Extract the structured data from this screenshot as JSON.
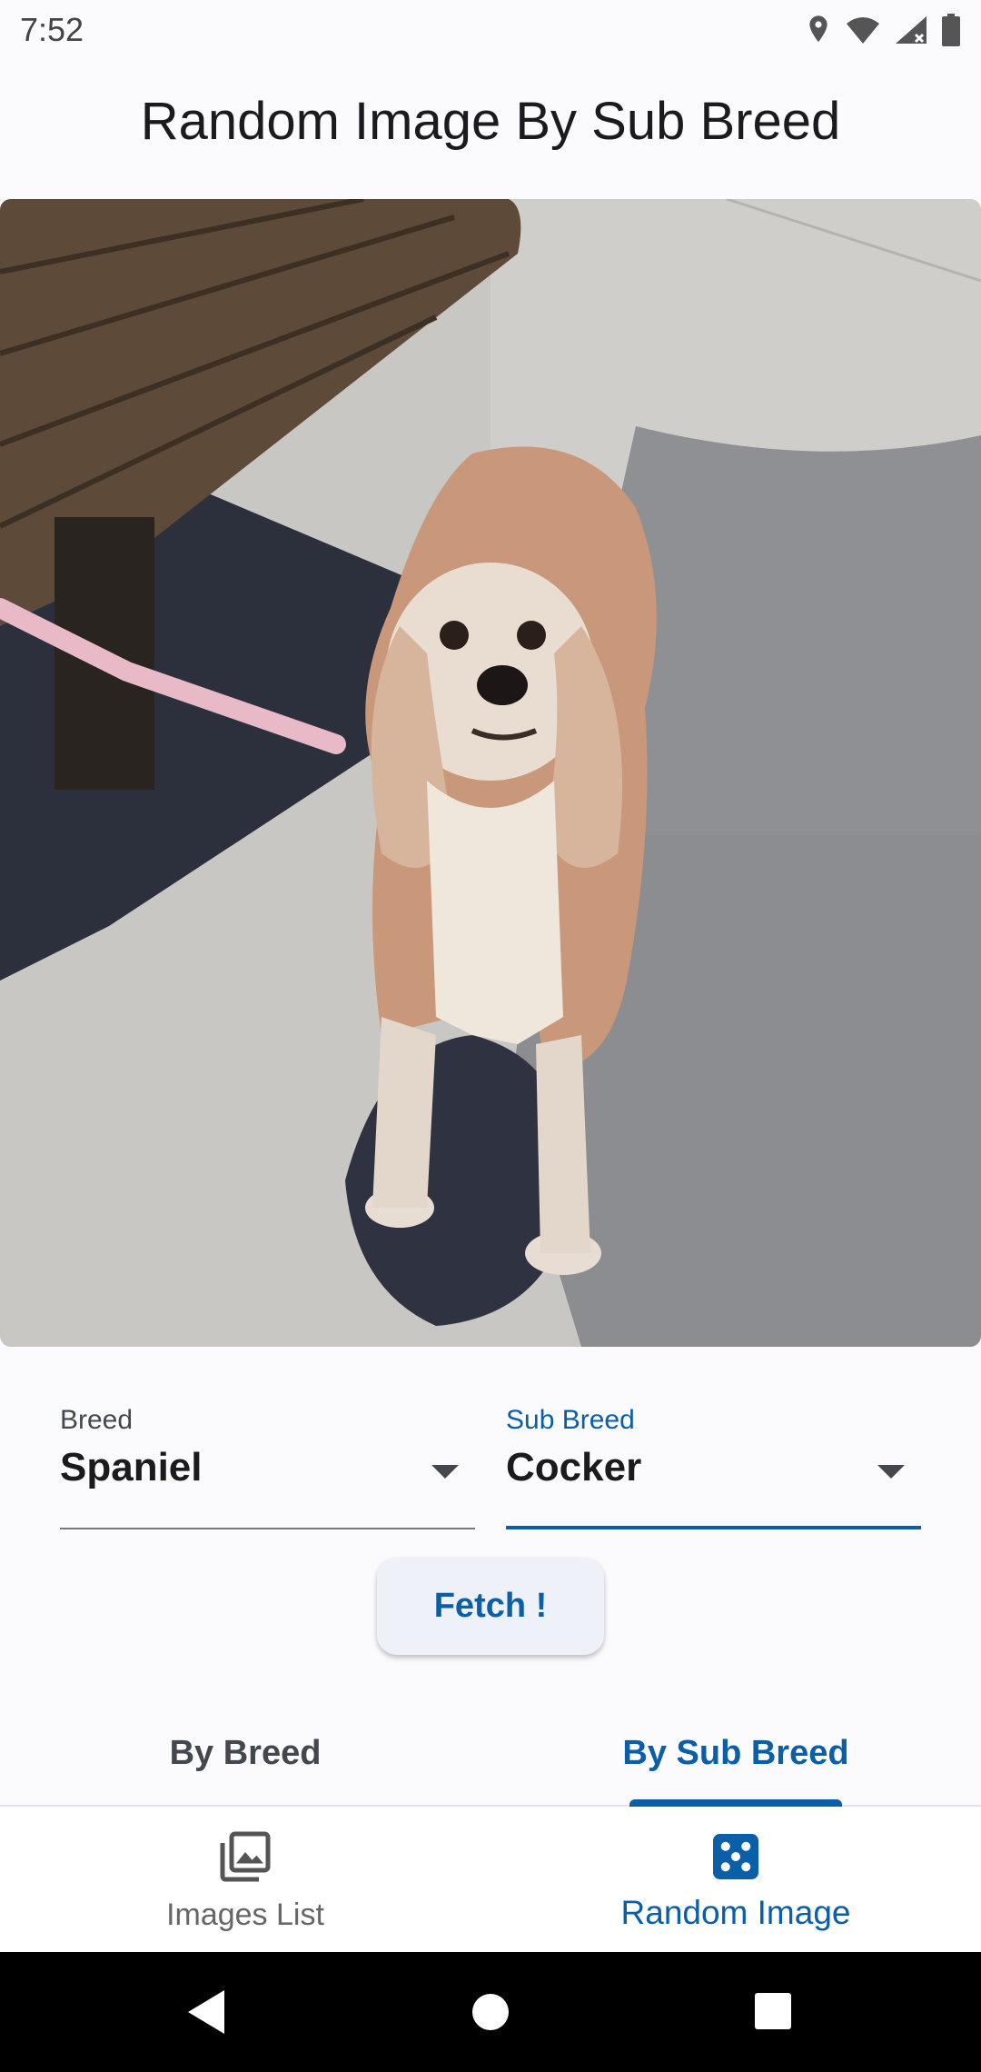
{
  "status_bar": {
    "time": "7:52",
    "icons": [
      "location-icon",
      "wifi-icon",
      "signal-icon",
      "battery-icon"
    ]
  },
  "app_bar": {
    "title": "Random Image By Sub Breed"
  },
  "image": {
    "description_icon": "dog-photo"
  },
  "form": {
    "breed": {
      "label": "Breed",
      "value": "Spaniel"
    },
    "sub_breed": {
      "label": "Sub Breed",
      "value": "Cocker"
    },
    "fetch_label": "Fetch !"
  },
  "tabs": [
    {
      "label": "By Breed",
      "selected": false
    },
    {
      "label": "By Sub Breed",
      "selected": true
    }
  ],
  "bottom_nav": [
    {
      "label": "Images List",
      "icon": "image-gallery-icon",
      "selected": false
    },
    {
      "label": "Random Image",
      "icon": "dice-icon",
      "selected": true
    }
  ],
  "colors": {
    "accent": "#0b5ea8",
    "background": "#fbfbfe"
  }
}
